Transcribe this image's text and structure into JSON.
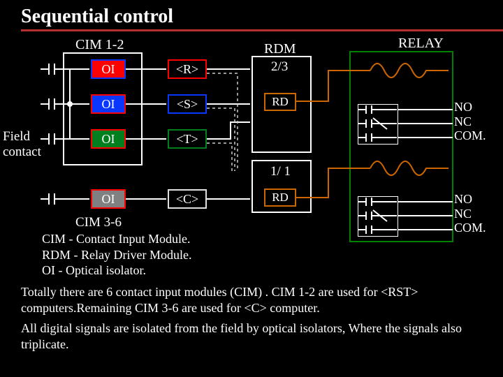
{
  "title": "Sequential control",
  "cim12_label": "CIM 1-2",
  "cim36_label": "CIM 3-6",
  "field_label_line1": "Field",
  "field_label_line2": "contact",
  "oi_label": "OI",
  "tags": {
    "r": "<R>",
    "s": "<S>",
    "t": "<T>",
    "c": "<C>"
  },
  "rdm_label": "RDM",
  "vote23": "2/3",
  "vote11": "1/ 1",
  "rd_label": "RD",
  "relay_label": "RELAY",
  "relay_terms": {
    "no": "NO",
    "nc": "NC",
    "com": "COM."
  },
  "legend": {
    "cim": "CIM - Contact Input Module.",
    "rdm": "RDM - Relay Driver Module.",
    "oi": "OI - Optical isolator."
  },
  "para1": "Totally there are 6 contact input modules (CIM) . CIM 1-2 are used for <RST> computers.Remaining CIM 3-6 are used for <C> computer.",
  "para2": "All digital signals are isolated from the field by optical isolators, Where the signals also triplicate.",
  "colors": {
    "r": "#ff0000",
    "s": "#0a37ff",
    "t": "#007f1f",
    "c": "#808080",
    "relay": "#cc6600",
    "underline": "#b52f2f"
  }
}
